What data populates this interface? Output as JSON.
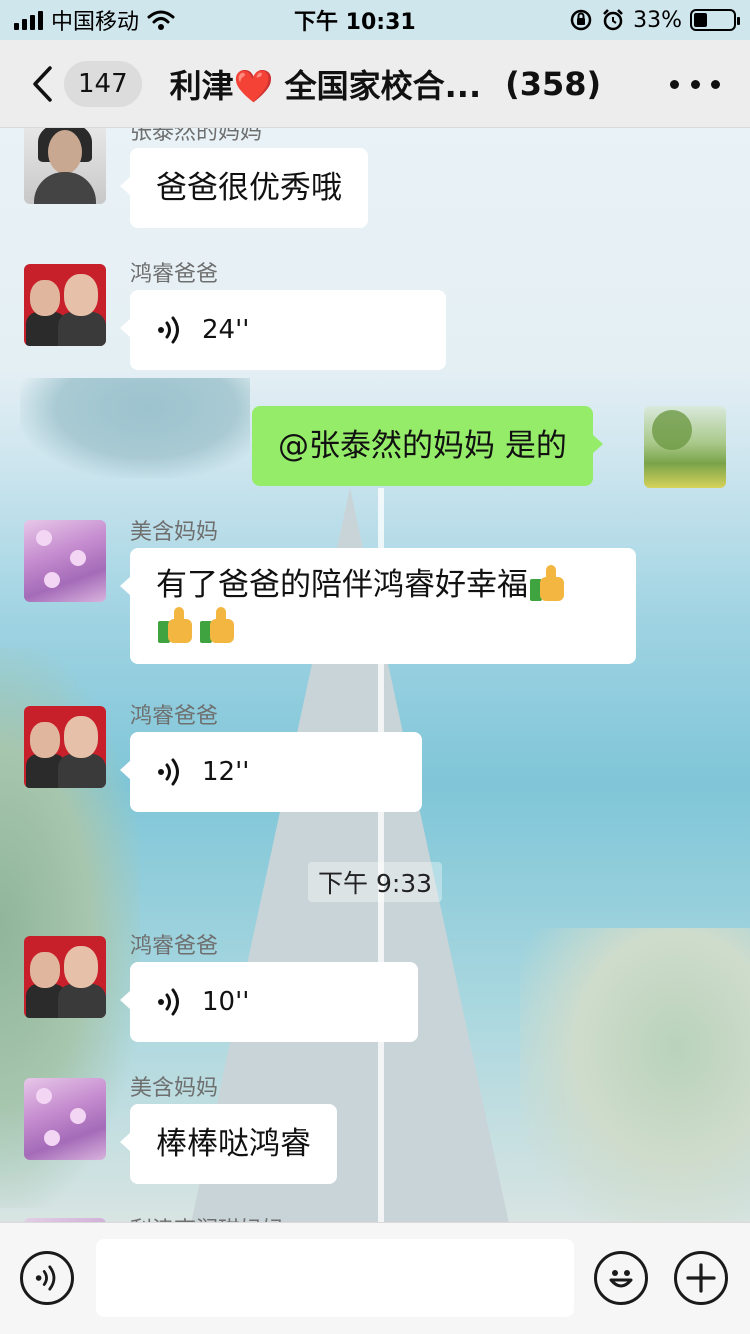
{
  "status_bar": {
    "carrier": "中国移动",
    "time": "下午 10:31",
    "battery_percent": "33%",
    "battery_level": 0.33,
    "icons": [
      "signal-icon",
      "wifi-icon",
      "orientation-lock-icon",
      "alarm-icon",
      "battery-icon"
    ]
  },
  "nav": {
    "back_badge": "147",
    "title": "利津❤️ 全国家校合...",
    "member_count": "(358)",
    "more_icon": "more-dots-icon"
  },
  "messages": [
    {
      "side": "left",
      "sender": "张泰然的妈妈",
      "avatar": "mom-avatar",
      "type": "text",
      "text": "爸爸很优秀哦"
    },
    {
      "side": "left",
      "sender": "鸿睿爸爸",
      "avatar": "father-son-avatar",
      "type": "voice",
      "duration": "24''"
    },
    {
      "side": "right",
      "sender": "",
      "avatar": "scenery-avatar",
      "type": "text",
      "text": "@张泰然的妈妈 是的"
    },
    {
      "side": "left",
      "sender": "美含妈妈",
      "avatar": "flower-avatar",
      "type": "text",
      "text_line1": "有了爸爸的陪伴鸿睿好幸福",
      "emoji": "thumbs-up-emoji"
    },
    {
      "side": "left",
      "sender": "鸿睿爸爸",
      "avatar": "father-son-avatar",
      "type": "voice",
      "duration": "12''"
    },
    {
      "timestamp": "下午 9:33"
    },
    {
      "side": "left",
      "sender": "鸿睿爸爸",
      "avatar": "father-son-avatar",
      "type": "voice",
      "duration": "10''"
    },
    {
      "side": "left",
      "sender": "美含妈妈",
      "avatar": "flower-avatar",
      "type": "text",
      "text": "棒棒哒鸿睿"
    },
    {
      "side": "left",
      "sender": "利津李润琪妈妈",
      "avatar": "partial-avatar",
      "type": "partial"
    }
  ],
  "input_bar": {
    "voice_toggle_icon": "voice-input-icon",
    "text_value": "",
    "emoji_icon": "emoji-icon",
    "plus_icon": "plus-icon"
  },
  "colors": {
    "nav_bg": "#ededed",
    "outgoing_bubble": "#95ec69",
    "incoming_bubble": "#ffffff"
  }
}
